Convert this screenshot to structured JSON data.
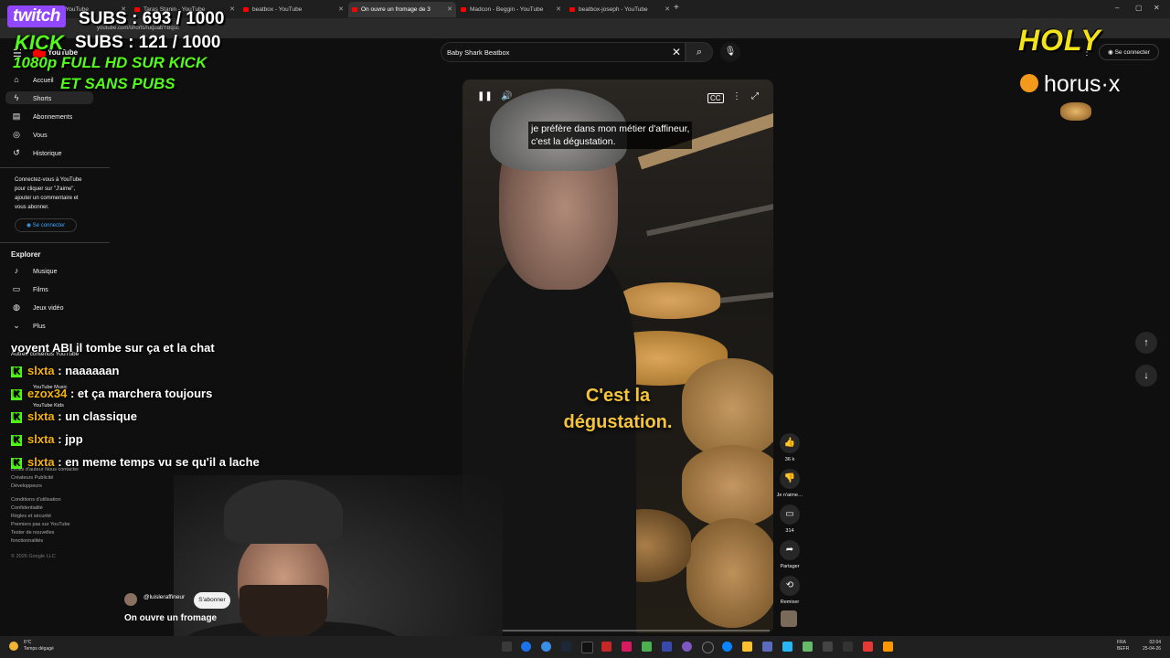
{
  "browser": {
    "tabs": [
      {
        "label": "Fanqueur - YouTube"
      },
      {
        "label": "Taras Stanin - YouTube"
      },
      {
        "label": "beatbox - YouTube"
      },
      {
        "label": "On ouvre un fromage de 3"
      },
      {
        "label": "Madcon - Beggin - YouTube"
      },
      {
        "label": "beatbox-joseph - YouTube"
      }
    ],
    "new_tab": "+",
    "url": "youtube.com/shorts/IuquabYBqsc"
  },
  "overlay": {
    "twitch_label": "twitch",
    "twitch_subs": "SUBS : 693 / 1000",
    "kick_label": "KICK",
    "kick_subs": "SUBS : 121 / 1000",
    "promo_line1": "1080p FULL HD SUR KICK",
    "promo_line2": "ET SANS PUBS",
    "holy": "HOLY",
    "sponsor": "horus·x",
    "chat": [
      {
        "user": "",
        "text": "voyent ABI il tombe sur ça et la chat",
        "badge": false
      },
      {
        "user": "slxta",
        "text": " : naaaaaan",
        "badge": true
      },
      {
        "user": "ezox34",
        "text": " : et ça marchera toujours",
        "badge": true
      },
      {
        "user": "slxta",
        "text": " : un classique",
        "badge": true
      },
      {
        "user": "slxta",
        "text": " : jpp",
        "badge": true
      },
      {
        "user": "slxta",
        "text": " : en meme temps vu se qu'il a lache",
        "badge": true
      }
    ],
    "kick_badge": "K"
  },
  "youtube": {
    "logo": "YouTube",
    "search": {
      "value": "Baby Shark Beatbox",
      "placeholder": "Rechercher"
    },
    "top_signin": "Se connecter",
    "sidebar": {
      "main": [
        {
          "label": "Accueil",
          "icon": "home-icon"
        },
        {
          "label": "Shorts",
          "icon": "shorts-icon"
        },
        {
          "label": "Abonnements",
          "icon": "subscriptions-icon"
        },
        {
          "label": "Vous",
          "icon": "you-icon"
        },
        {
          "label": "Historique",
          "icon": "history-icon"
        }
      ],
      "signin_prompt": [
        "Connectez-vous à YouTube",
        "pour cliquer sur \"J'aime\",",
        "ajouter un commentaire et",
        "vous abonner."
      ],
      "signin_button": "Se connecter",
      "explore_title": "Explorer",
      "explore": [
        {
          "label": "Musique",
          "icon": "music-icon"
        },
        {
          "label": "Films",
          "icon": "film-icon"
        },
        {
          "label": "Jeux vidéo",
          "icon": "gaming-icon"
        },
        {
          "label": "Plus",
          "icon": "chevron-down-icon"
        }
      ],
      "more_title": "Autres contenus YouTube",
      "more": [
        {
          "label": "YouTube Music"
        },
        {
          "label": "YouTube Kids"
        }
      ],
      "footer_links": [
        "Droits d'auteur  Nous contacter",
        "Créateurs  Publicité",
        "Développeurs"
      ],
      "footer_links2": [
        "Conditions d'utilisation",
        "Confidentialité",
        "Règles et sécurité",
        "Premiers pas sur YouTube",
        "Tester de nouvelles",
        "fonctionnalités"
      ],
      "copyright": "© 2026 Google LLC"
    },
    "video": {
      "caption_top_line1": "je préfère dans mon métier d'affineur,",
      "caption_top_line2": "c'est la dégustation.",
      "caption_big_line1": "C'est la",
      "caption_big_line2": "dégustation.",
      "progress": 0.08
    },
    "actions": {
      "likes": "36 k",
      "dislike_label": "Je n'aime…",
      "comments": "314",
      "share_label": "Partager",
      "remix_label": "Remixer"
    },
    "channel": "@luisleraffineur",
    "subscribe": "S'abonner",
    "title": "On ouvre un fromage"
  },
  "taskbar": {
    "weather_temp": "6°C",
    "weather_desc": "Temps dégagé",
    "lang_1": "FRA",
    "lang_2": "BEFR",
    "time": "02:04",
    "date": "25-04-26"
  }
}
